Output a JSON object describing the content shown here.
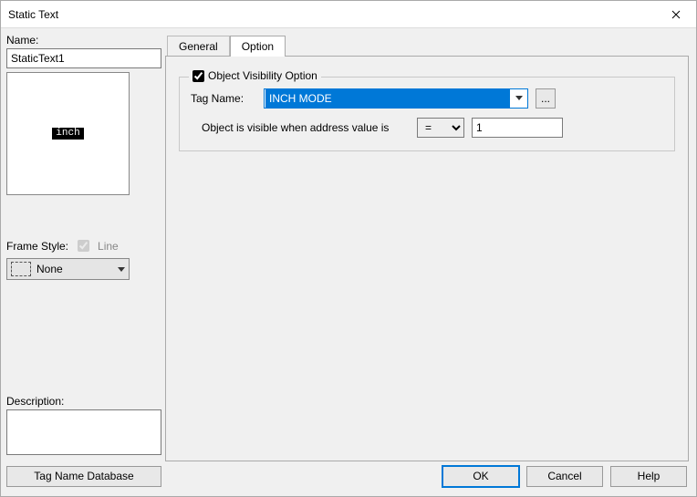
{
  "window": {
    "title": "Static Text"
  },
  "left": {
    "name_label": "Name:",
    "name_value": "StaticText1",
    "preview_text": "inch",
    "frame_style_label": "Frame Style:",
    "line_label": "Line",
    "line_checked": true,
    "frame_style_value": "None",
    "description_label": "Description:",
    "description_value": ""
  },
  "tabs": {
    "general": "General",
    "option": "Option",
    "active": "option"
  },
  "option": {
    "group_label": "Object Visibility Option",
    "group_checked": true,
    "tag_name_label": "Tag Name:",
    "tag_name_value": "INCH MODE",
    "dots": "...",
    "visible_label": "Object is visible when address value is",
    "operator": "=",
    "value": "1"
  },
  "buttons": {
    "tagdb": "Tag Name Database",
    "ok": "OK",
    "cancel": "Cancel",
    "help": "Help"
  }
}
